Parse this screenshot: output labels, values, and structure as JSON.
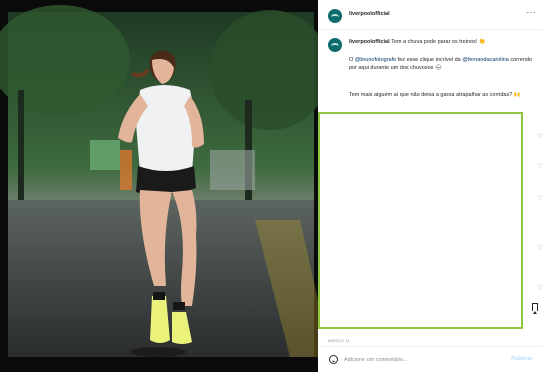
{
  "post": {
    "username": "liverpoolofficial",
    "more_icon": "more-horizontal-icon"
  },
  "caption": {
    "username": "liverpoolofficial",
    "text": "Tem a chuva pode parar os treinos!",
    "emoji": "👏",
    "mention_prefix": "O",
    "mention_1": "@brunofotografo",
    "line2_mid": "fez esse clique incrível da",
    "mention_2": "@fernandacarolina",
    "line2_end": "correndo por aqui durante um dos chuvosos",
    "emoji_2": "🌧",
    "question": "Tem mais alguém aí que não deixa a garoa atrapalhar as corridas?",
    "emoji_3": "🙌"
  },
  "footer": {
    "likes_line": "",
    "date": "MARÇO 11"
  },
  "comment": {
    "placeholder": "Adicione um comentário...",
    "publish_label": "Publicar"
  },
  "colors": {
    "highlight_box": "#8dc63f",
    "link": "#00376b",
    "avatar": "#0f6b6b"
  }
}
